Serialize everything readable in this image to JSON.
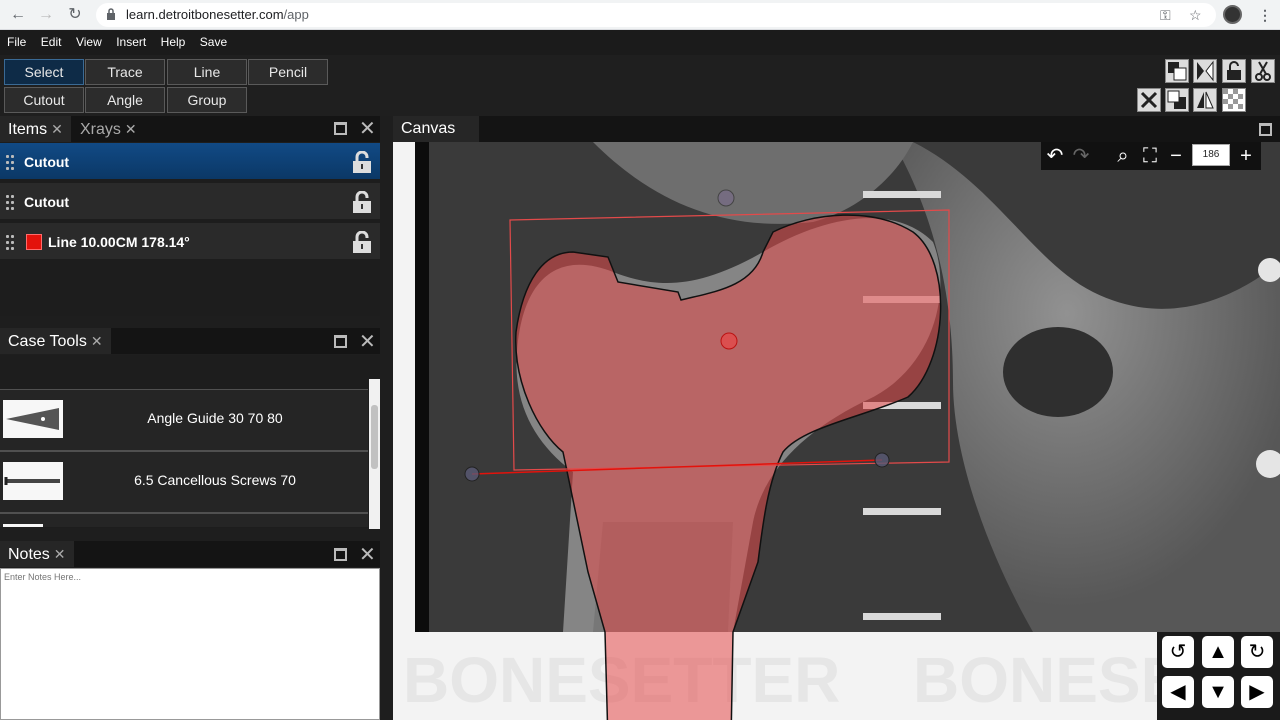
{
  "browser": {
    "url_host": "learn.detroitbonesetter.com",
    "url_path": "/app"
  },
  "menu": [
    "File",
    "Edit",
    "View",
    "Insert",
    "Help",
    "Save"
  ],
  "tools": {
    "row1": [
      "Select",
      "Trace",
      "Line",
      "Pencil"
    ],
    "row2": [
      "Cutout",
      "Angle",
      "Group"
    ],
    "active": "Select"
  },
  "items_panel": {
    "tab_items": "Items",
    "tab_xrays": "Xrays",
    "rows": [
      {
        "label": "Cutout"
      },
      {
        "label": "Cutout"
      },
      {
        "label": "Line 10.00CM 178.14°"
      }
    ]
  },
  "case_tools": {
    "title": "Case Tools",
    "items": [
      {
        "label": "Angle Guide 30 70 80"
      },
      {
        "label": "6.5 Cancellous Screws 70"
      }
    ]
  },
  "notes": {
    "title": "Notes",
    "placeholder": "Enter Notes Here..."
  },
  "canvas": {
    "title": "Canvas",
    "zoom": "186",
    "watermark": "BONESETTER",
    "accent": "#e3120b"
  }
}
